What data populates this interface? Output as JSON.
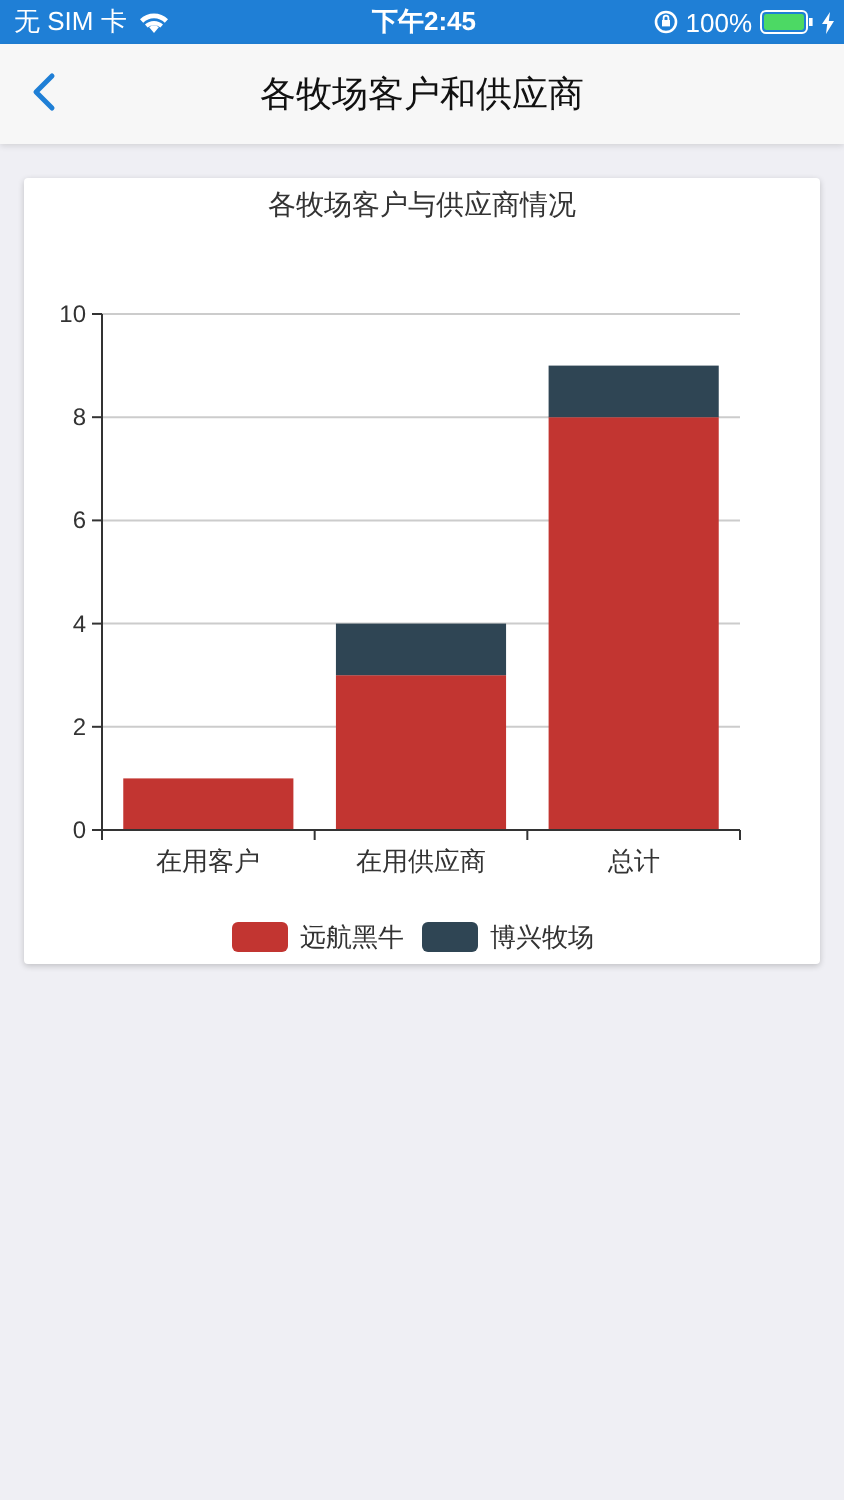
{
  "status_bar": {
    "carrier": "无 SIM 卡",
    "time": "下午2:45",
    "battery": "100%"
  },
  "nav": {
    "title": "各牧场客户和供应商"
  },
  "card": {
    "chart_data": {
      "type": "bar",
      "title": "各牧场客户与供应商情况",
      "stacked": true,
      "categories": [
        "在用客户",
        "在用供应商",
        "总计"
      ],
      "series": [
        {
          "name": "远航黑牛",
          "color": "#c23531",
          "values": [
            1,
            3,
            8
          ]
        },
        {
          "name": "博兴牧场",
          "color": "#2f4554",
          "values": [
            0,
            1,
            1
          ]
        }
      ],
      "ylim": [
        0,
        10
      ],
      "yticks": [
        0,
        2,
        4,
        6,
        8,
        10
      ],
      "grid": true,
      "legend": true
    }
  }
}
